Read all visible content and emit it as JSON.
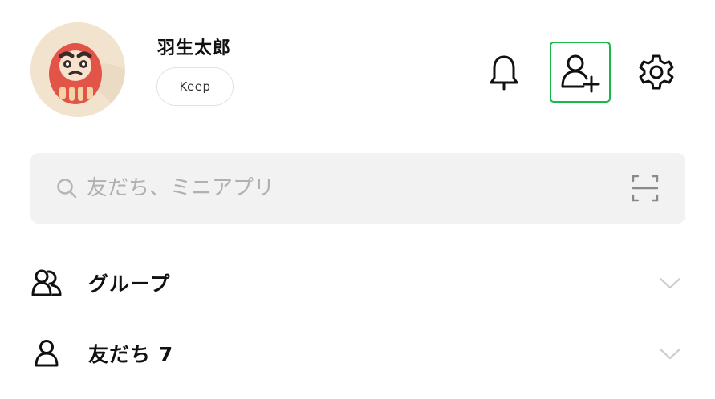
{
  "profile": {
    "name": "羽生太郎",
    "keep_label": "Keep",
    "avatar_icon": "daruma-avatar"
  },
  "header_actions": {
    "notifications_icon": "bell-icon",
    "add_friend_icon": "add-friend-icon",
    "settings_icon": "gear-icon",
    "add_friend_highlight_color": "#19b84d"
  },
  "search": {
    "placeholder": "友だち、ミニアプリ",
    "value": "",
    "scan_icon": "qr-scan-icon"
  },
  "list": {
    "groups_label": "グループ",
    "friends_label": "友だち 7"
  }
}
